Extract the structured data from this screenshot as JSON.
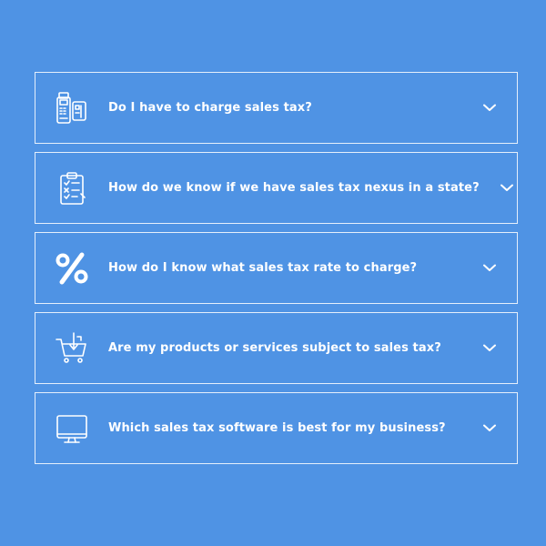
{
  "theme": {
    "background": "#4f93e4",
    "foreground": "#ffffff"
  },
  "faq": {
    "items": [
      {
        "question": "Do I have to charge sales tax?",
        "icon": "card-terminal-icon"
      },
      {
        "question": "How do we know if we have sales tax nexus in a state?",
        "icon": "clipboard-checklist-icon"
      },
      {
        "question": "How do I know what sales tax rate to charge?",
        "icon": "percent-icon"
      },
      {
        "question": "Are my products or services subject to sales tax?",
        "icon": "shopping-cart-icon"
      },
      {
        "question": "Which sales tax software is best for my business?",
        "icon": "computer-monitor-icon"
      }
    ]
  }
}
